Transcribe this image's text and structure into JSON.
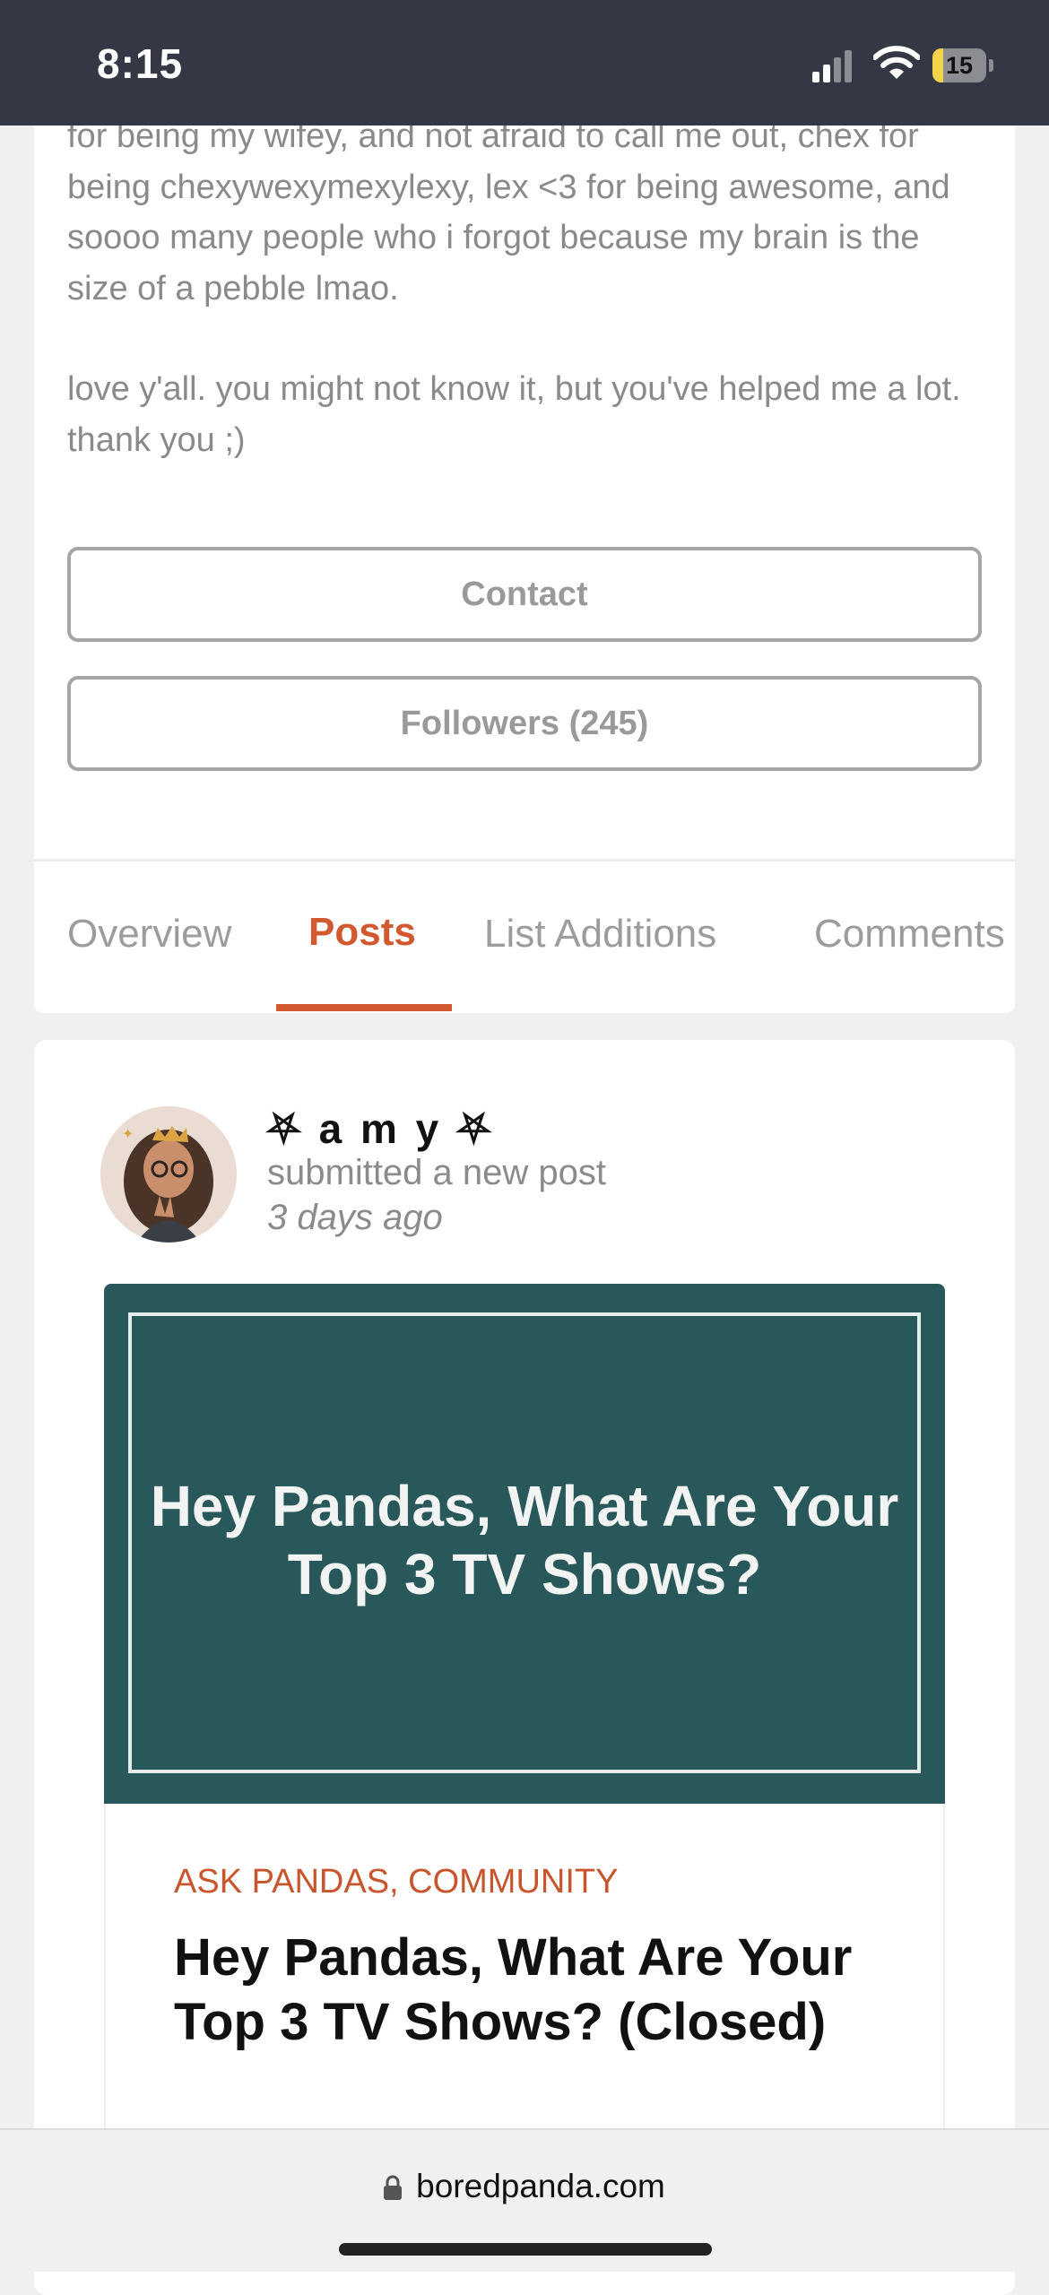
{
  "status_bar": {
    "time": "8:15",
    "battery_level": "15",
    "icons": [
      "signal-icon",
      "wifi-icon",
      "battery-icon"
    ]
  },
  "profile": {
    "bio_paragraphs": [
      "for being my wifey, and not afraid to call me out, chex for being chexywexymexylexy, lex <3 for being awesome, and soooo many people who i forgot because my brain is the size of a pebble lmao.",
      "love y'all. you might not know it, but you've helped me a lot. thank you ;)"
    ],
    "contact_label": "Contact",
    "followers_label": "Followers (245)"
  },
  "tabs": [
    {
      "label": "Overview",
      "active": false
    },
    {
      "label": "Posts",
      "active": true
    },
    {
      "label": "List Additions",
      "active": false
    },
    {
      "label": "Comments",
      "active": false
    }
  ],
  "post": {
    "username": "⛧ a m y ⛧",
    "action": "submitted a new post",
    "time_ago": "3 days ago",
    "thumbnail_text": "Hey Pandas, What Are Your Top 3 TV Shows?",
    "categories": "ASK PANDAS, COMMUNITY",
    "title": "Hey Pandas, What Are Your Top 3 TV Shows? (Closed)"
  },
  "browser": {
    "url": "boredpanda.com"
  },
  "colors": {
    "accent": "#d2592f",
    "status_bar_bg": "#353844",
    "thumbnail_bg": "#29585a",
    "battery_yellow": "#f3d34a"
  }
}
